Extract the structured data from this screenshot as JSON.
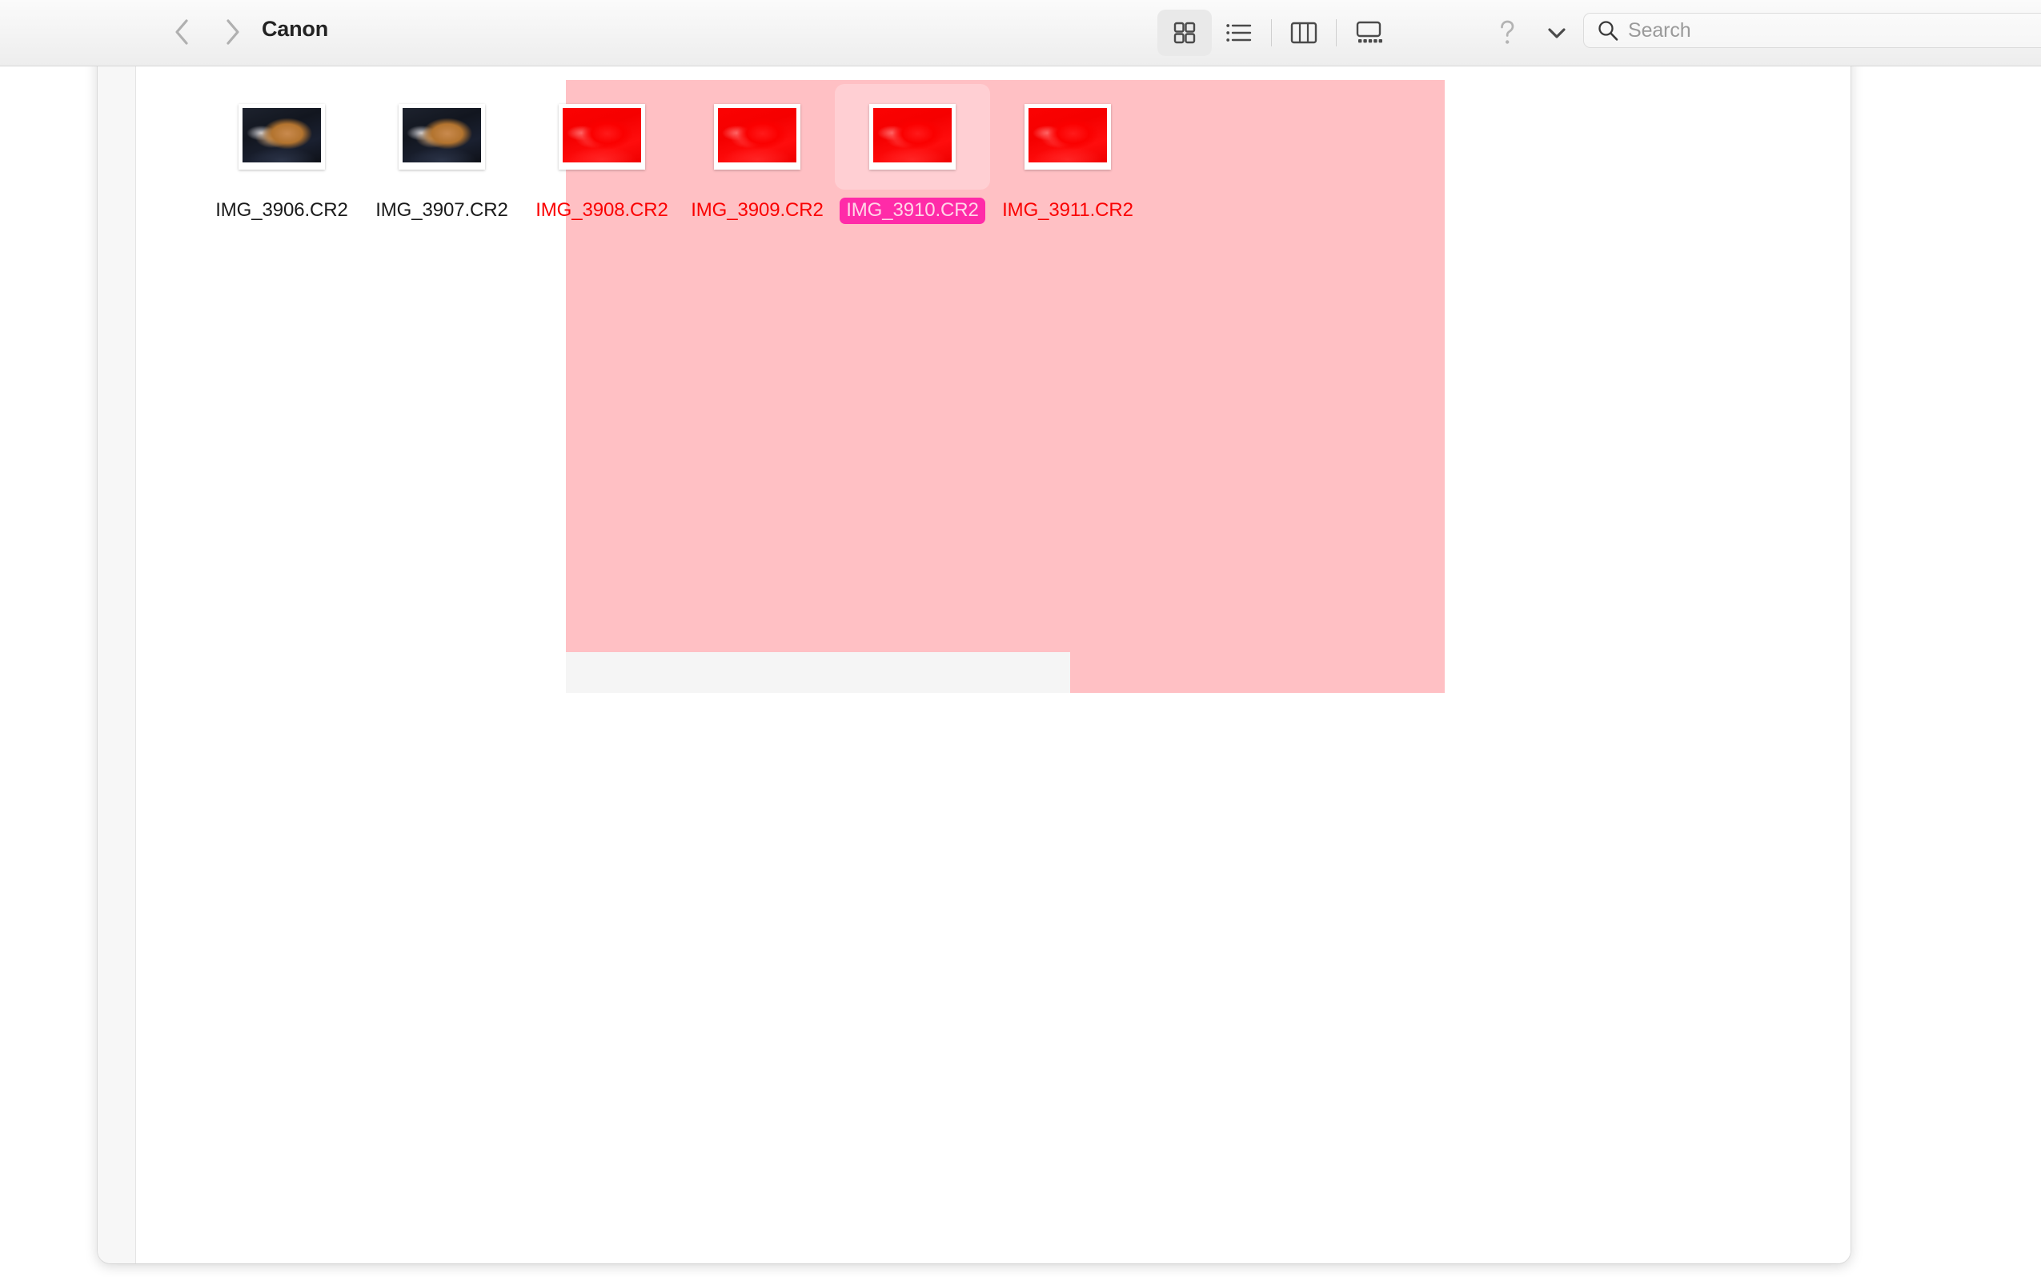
{
  "window": {
    "title": "Canon"
  },
  "toolbar": {
    "back_label": "Back",
    "forward_label": "Forward",
    "view_modes": [
      {
        "name": "icon-view",
        "label": "Icon View",
        "active": true
      },
      {
        "name": "list-view",
        "label": "List View",
        "active": false
      },
      {
        "name": "column-view",
        "label": "Column View",
        "active": false
      },
      {
        "name": "gallery-view",
        "label": "Gallery View",
        "active": false
      }
    ],
    "help_label": "?",
    "more_label": "More",
    "search": {
      "placeholder": "Search",
      "value": ""
    }
  },
  "files": [
    {
      "name": "IMG_3906.CR2",
      "selected": false,
      "red": false
    },
    {
      "name": "IMG_3907.CR2",
      "selected": false,
      "red": false
    },
    {
      "name": "IMG_3908.CR2",
      "selected": false,
      "red": true
    },
    {
      "name": "IMG_3909.CR2",
      "selected": false,
      "red": true
    },
    {
      "name": "IMG_3910.CR2",
      "selected": true,
      "red": true
    },
    {
      "name": "IMG_3911.CR2",
      "selected": false,
      "red": true
    }
  ],
  "colors": {
    "pink_overlay": "#ffc0c4",
    "selection_badge": "#ff2ba8",
    "selection_badge_text": "#ffd6e8",
    "red_text": "#fa0000",
    "gray_patch": "#f5f5f5",
    "toolbar_title": "#232323",
    "search_placeholder": "#9a9a9a"
  }
}
